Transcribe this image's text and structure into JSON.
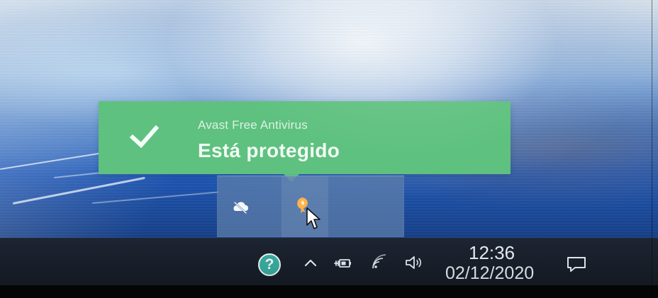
{
  "toast": {
    "app_name": "Avast Free Antivirus",
    "message": "Está protegido",
    "background_color": "#5ec17f",
    "icon": "check-icon"
  },
  "tray_popup": {
    "icons": [
      "cloud-off-icon",
      "avast-icon"
    ],
    "selected_index": 1,
    "background_color": "#5e7faa"
  },
  "taskbar": {
    "help_label": "?",
    "tray_icons": [
      "help-icon",
      "chevron-up-icon",
      "battery-charging-icon",
      "wifi-icon",
      "volume-icon",
      "notification-icon"
    ],
    "clock": {
      "time": "12:36",
      "date": "02/12/2020"
    }
  },
  "cursor": "arrow-cursor-icon"
}
